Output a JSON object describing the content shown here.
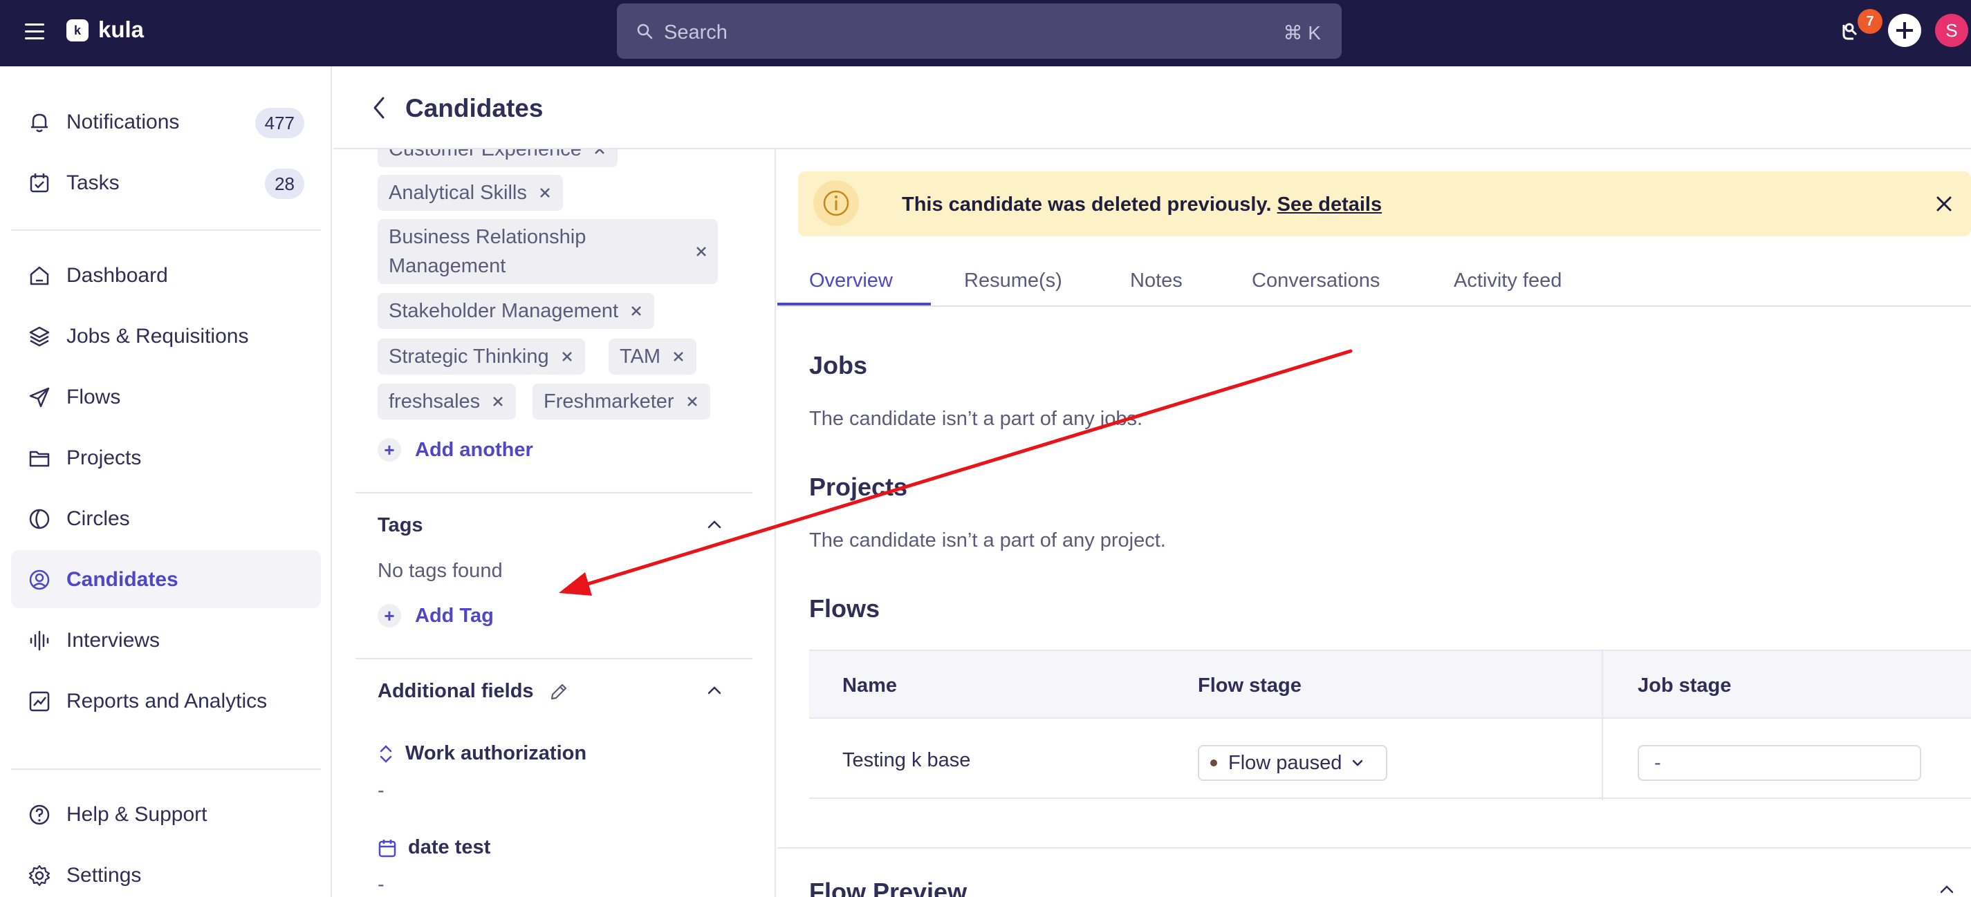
{
  "topbar": {
    "app_name": "kula",
    "search_placeholder": "Search",
    "search_shortcut": "⌘ K",
    "notification_badge": "7",
    "avatar_initial": "S"
  },
  "sidebar": {
    "items": [
      {
        "label": "Notifications",
        "count": "477",
        "icon": "bell-icon"
      },
      {
        "label": "Tasks",
        "count": "28",
        "icon": "calendar-icon"
      },
      {
        "label": "Dashboard",
        "icon": "home-icon"
      },
      {
        "label": "Jobs & Requisitions",
        "icon": "layers-icon"
      },
      {
        "label": "Flows",
        "icon": "send-icon"
      },
      {
        "label": "Projects",
        "icon": "folder-icon"
      },
      {
        "label": "Circles",
        "icon": "circles-icon"
      },
      {
        "label": "Candidates",
        "icon": "user-circle-icon",
        "active": true
      },
      {
        "label": "Interviews",
        "icon": "audio-icon"
      },
      {
        "label": "Reports and Analytics",
        "icon": "chart-icon"
      }
    ],
    "footer": [
      {
        "label": "Help & Support",
        "icon": "help-icon"
      },
      {
        "label": "Settings",
        "icon": "gear-icon"
      }
    ]
  },
  "header": {
    "title": "Candidates"
  },
  "skills": {
    "chips": [
      "Customer Experience",
      "Analytical Skills",
      "Business Relationship Management",
      "Stakeholder Management",
      "Strategic Thinking",
      "TAM",
      "freshsales",
      "Freshmarketer"
    ],
    "add_label": "Add another"
  },
  "tags": {
    "title": "Tags",
    "empty_text": "No tags found",
    "add_label": "Add Tag"
  },
  "additional_fields": {
    "title": "Additional fields",
    "fields": [
      {
        "label": "Work authorization",
        "value": "-"
      },
      {
        "label": "date test",
        "value": "-"
      }
    ]
  },
  "alert": {
    "text": "This candidate was deleted previously.",
    "link": "See details"
  },
  "tabs": [
    "Overview",
    "Resume(s)",
    "Notes",
    "Conversations",
    "Activity feed"
  ],
  "jobs": {
    "title": "Jobs",
    "text": "The candidate isn’t a part of any jobs."
  },
  "projects": {
    "title": "Projects",
    "text": "The candidate isn’t a part of any project."
  },
  "flows": {
    "title": "Flows",
    "columns": [
      "Name",
      "Flow stage",
      "Job stage"
    ],
    "rows": [
      {
        "name": "Testing k base",
        "flow_stage": "Flow paused",
        "job_stage": "-"
      }
    ]
  },
  "flow_preview": {
    "title": "Flow Preview"
  },
  "colors": {
    "brand_dark": "#1d1b45",
    "accent": "#4f46c8",
    "alert_bg": "#fdf1c8",
    "annotation_arrow": "#e8141a"
  }
}
